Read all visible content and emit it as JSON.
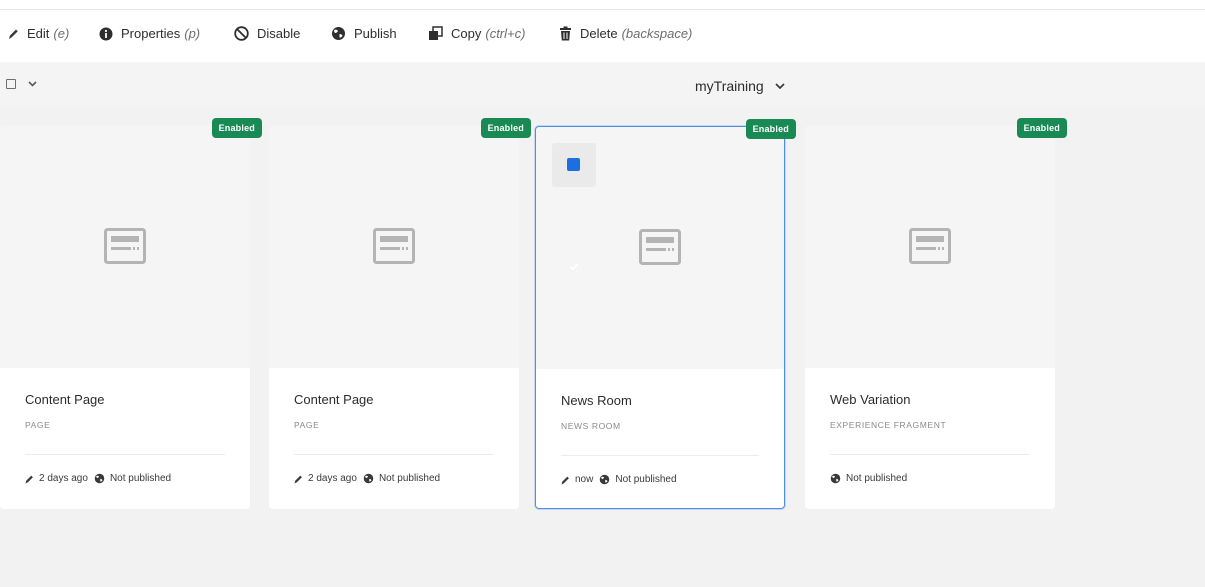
{
  "toolbar": {
    "edit": {
      "label": "Edit",
      "shortcut": "(e)",
      "icon": "pencil-icon"
    },
    "properties": {
      "label": "Properties",
      "shortcut": "(p)",
      "icon": "info-icon"
    },
    "disable": {
      "label": "Disable",
      "icon": "ban-icon"
    },
    "publish": {
      "label": "Publish",
      "icon": "globe-icon"
    },
    "copy": {
      "label": "Copy",
      "shortcut": "(ctrl+c)",
      "icon": "copy-icon"
    },
    "delete": {
      "label": "Delete",
      "shortcut": "(backspace)",
      "icon": "trash-icon"
    }
  },
  "subbar": {
    "path_title": "myTraining"
  },
  "colors": {
    "badge": "#1a8a55",
    "selection": "#4b8fe8",
    "checkbox": "#1c6fe0"
  },
  "cards": [
    {
      "title": "Content Page",
      "type": "PAGE",
      "badge": "Enabled",
      "modified": "2 days ago",
      "status": "Not published",
      "selected": false
    },
    {
      "title": "Content Page",
      "type": "PAGE",
      "badge": "Enabled",
      "modified": "2 days ago",
      "status": "Not published",
      "selected": false
    },
    {
      "title": "News Room",
      "type": "NEWS ROOM",
      "badge": "Enabled",
      "modified": "now",
      "status": "Not published",
      "selected": true
    },
    {
      "title": "Web Variation",
      "type": "EXPERIENCE FRAGMENT",
      "badge": "Enabled",
      "modified": "",
      "status": "Not published",
      "selected": false
    }
  ]
}
